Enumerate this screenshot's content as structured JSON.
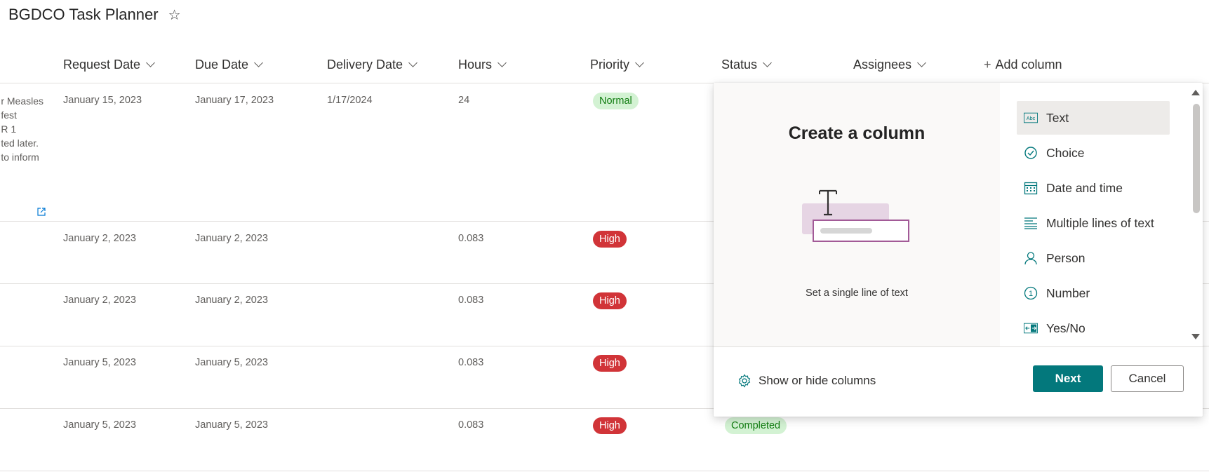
{
  "app": {
    "title": "BGDCO Task Planner"
  },
  "header": {
    "columns": [
      "Request Date",
      "Due Date",
      "Delivery Date",
      "Hours",
      "Priority",
      "Status",
      "Assignees"
    ],
    "add_column": "Add column"
  },
  "rows": [
    {
      "desc_lines": [
        "r Measles",
        "fest",
        "R 1",
        "ted later.",
        "to inform"
      ],
      "request_date": "January 15, 2023",
      "due_date": "January 17, 2023",
      "delivery_date": "1/17/2024",
      "hours": "24",
      "priority": "Normal"
    },
    {
      "request_date": "January 2, 2023",
      "due_date": "January 2, 2023",
      "hours": "0.083",
      "priority": "High"
    },
    {
      "request_date": "January 2, 2023",
      "due_date": "January 2, 2023",
      "hours": "0.083",
      "priority": "High"
    },
    {
      "request_date": "January 5, 2023",
      "due_date": "January 5, 2023",
      "hours": "0.083",
      "priority": "High"
    },
    {
      "request_date": "January 5, 2023",
      "due_date": "January 5, 2023",
      "hours": "0.083",
      "priority": "High",
      "status": "Completed"
    }
  ],
  "panel": {
    "title": "Create a column",
    "description": "Set a single line of text",
    "types": [
      {
        "label": "Text",
        "icon": "text-abc-icon",
        "selected": true
      },
      {
        "label": "Choice",
        "icon": "choice-check-icon"
      },
      {
        "label": "Date and time",
        "icon": "calendar-icon"
      },
      {
        "label": "Multiple lines of text",
        "icon": "multiline-text-icon"
      },
      {
        "label": "Person",
        "icon": "person-icon"
      },
      {
        "label": "Number",
        "icon": "number-icon"
      },
      {
        "label": "Yes/No",
        "icon": "yes-no-icon"
      }
    ],
    "show_hide": "Show or hide columns",
    "next": "Next",
    "cancel": "Cancel"
  },
  "colors": {
    "accent": "#03787c",
    "high": "#d13438",
    "normal_bg": "#d3f2d3",
    "normal_text": "#107c10"
  }
}
